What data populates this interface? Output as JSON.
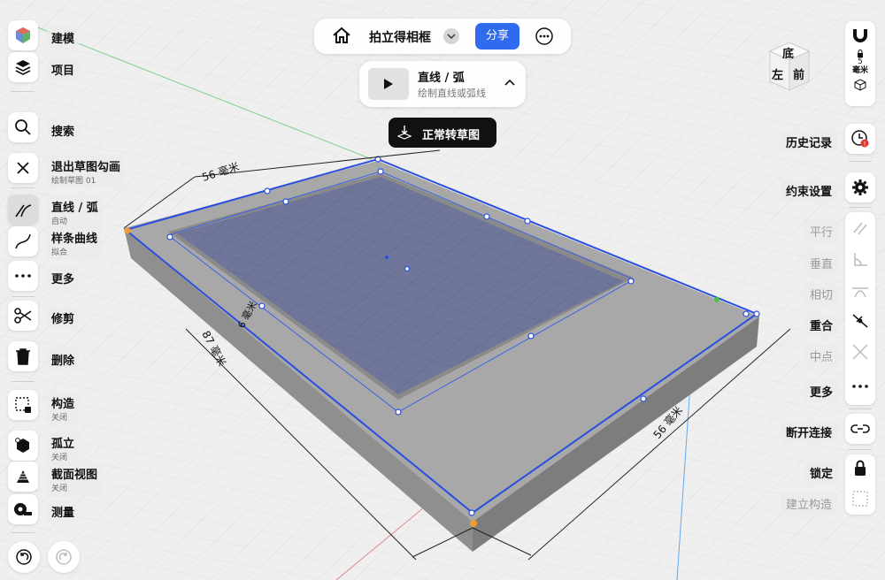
{
  "top_bar": {
    "title": "拍立得相框",
    "share_label": "分享"
  },
  "tool_card": {
    "title": "直线 / 弧",
    "subtitle": "绘制直线或弧线"
  },
  "mode_banner": {
    "label": "正常转草图"
  },
  "left_toolbar": {
    "model": "建模",
    "project": "项目",
    "search": "搜索",
    "exit_sketch": "退出草图勾画",
    "exit_sketch_sub": "绘制草图 01",
    "line_arc": "直线 / 弧",
    "line_arc_sub": "自动",
    "spline": "样条曲线",
    "spline_sub": "拟合",
    "more": "更多",
    "trim": "修剪",
    "delete": "删除",
    "construct": "构造",
    "construct_sub": "关闭",
    "isolate": "孤立",
    "isolate_sub": "关闭",
    "section_view": "截面视图",
    "section_view_sub": "关闭",
    "measure": "测量"
  },
  "right_toolbar": {
    "snap_value": "5",
    "snap_unit": "毫米",
    "history": "历史记录",
    "constraint_settings": "约束设置",
    "parallel": "平行",
    "perpendicular": "垂直",
    "tangent": "相切",
    "coincident": "重合",
    "midpoint": "中点",
    "more": "更多",
    "break_link": "断开连接",
    "lock": "锁定",
    "build_construct": "建立构造"
  },
  "view_cube": {
    "face_top": "底",
    "face_front": "前",
    "face_right": "左"
  },
  "dimensions": {
    "top": "56 毫米",
    "left": "87 毫米",
    "bottom": "56 毫米",
    "left_small": "6 毫米"
  },
  "colors": {
    "accent": "#2f6bef",
    "sketch_line": "#2a4fe0",
    "fill": "#6f7699",
    "body": "#a7a7a7"
  }
}
